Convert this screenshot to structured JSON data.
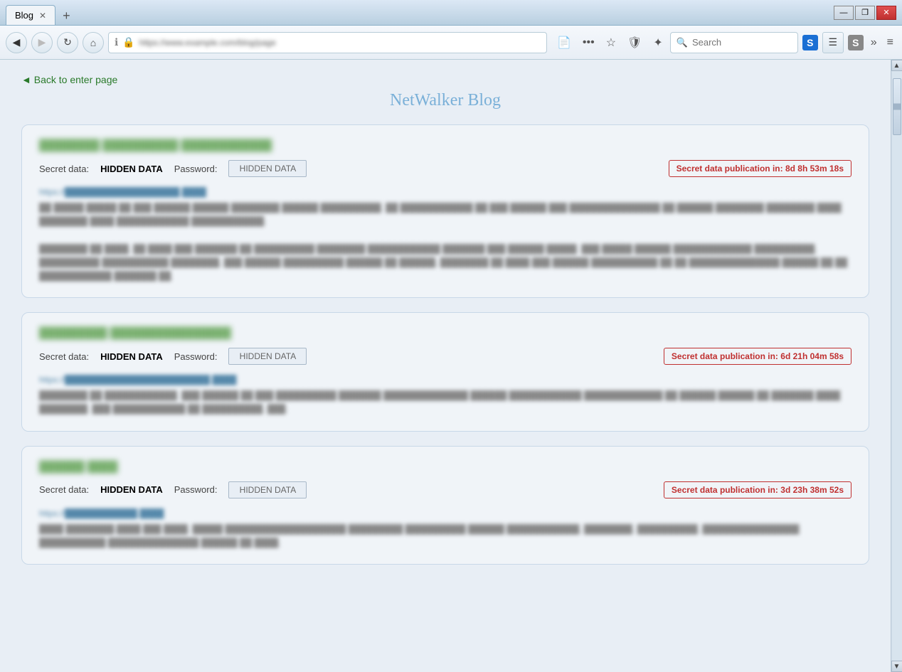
{
  "titlebar": {
    "tab_label": "Blog",
    "new_tab_icon": "+",
    "minimize": "—",
    "maximize": "❐",
    "close": "✕"
  },
  "navbar": {
    "back_title": "Back",
    "forward_title": "Forward",
    "reload_title": "Reload",
    "home_title": "Home",
    "address_placeholder": "https://www.example.com/blog/page",
    "search_placeholder": "Search",
    "more_icon": "•••",
    "star_icon": "☆",
    "shield_icon": "🛡",
    "magic_icon": "✦",
    "search_icon": "🔍",
    "overflow_icon": "»",
    "menu_icon": "≡",
    "reader_icon": "≡",
    "s_blue": "S",
    "s_gray": "S"
  },
  "page": {
    "back_link": "◄ Back to enter page",
    "blog_title": "NetWalker Blog"
  },
  "cards": [
    {
      "title": "████████ ██████████ ████████████",
      "secret_label": "Secret data:",
      "secret_value": "HIDDEN DATA",
      "password_label": "Password:",
      "password_value": "HIDDEN DATA",
      "publication_label": "Secret data publication in: 8d 8h 53m 18s",
      "url": "https://███████████████████.████",
      "body_lines": [
        "██ █████ █████ ██ ███ ██████ ██████ ████████ ██████ ██████████. ██ ████████████ ██ ███ ██████ ███ ███████████████ ██ ██████ ████████ ████████ ████ ████████ ████ ████████████ ████████████.",
        "████████ ██ ████, ██ ████ ███ ███████ ██ ██████████ ████████ ████████████ ███████ ███ ██████ █████. ███ █████ ██████ █████████████ ██████████, ██████████ ███████████ ████████, ███ ██████ ██████████ ██████ ██ ██████, ████████ ██ ████ ███ ██████ ███████████ ██ ██ ███████████████ ██████ ██ ██ ████████████ ███████ ██."
      ]
    },
    {
      "title": "█████████ ████████████████",
      "secret_label": "Secret data:",
      "secret_value": "HIDDEN DATA",
      "password_label": "Password:",
      "password_value": "HIDDEN DATA",
      "publication_label": "Secret data publication in: 6d 21h 04m 58s",
      "url": "https://████████████████████████.████",
      "body_lines": [
        "████████ ██ ████████████. ███ ██████ ██ ███ ██████████ ███████ ██████████████ ██████ ████████████ █████████████ ██ ██████ ██████ ██ ███████ ████ ████████. ███ ████████████ ██ ██████████, ███."
      ]
    },
    {
      "title": "██████ ████",
      "secret_label": "Secret data:",
      "secret_value": "HIDDEN DATA",
      "password_label": "Password:",
      "password_value": "HIDDEN DATA",
      "publication_label": "Secret data publication in: 3d 23h 38m 52s",
      "url": "https://████████████.████",
      "body_lines": [
        "████ ████████.████ ███ ████, █████ ████████████████████ █████████ ██████████ ██████ ████████████, ████████, ██████████, ████████████████ ███████████ ███████████████ ██████ ██ ████."
      ]
    }
  ]
}
